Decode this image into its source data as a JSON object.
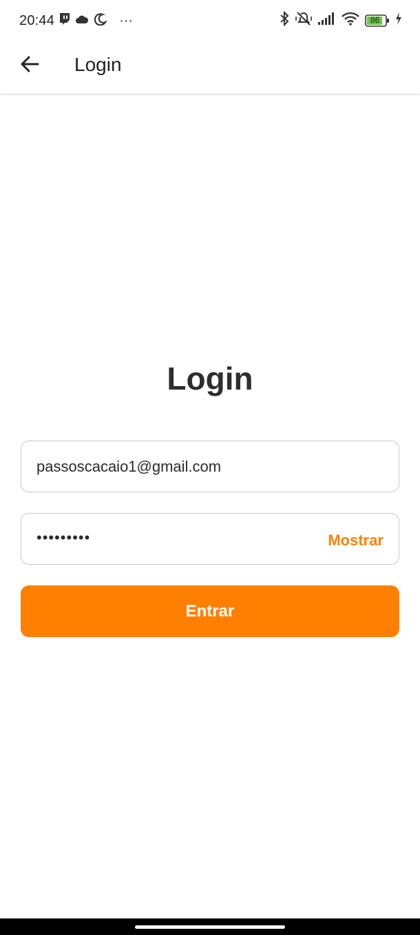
{
  "status_bar": {
    "time": "20:44",
    "left_icons": [
      "twitch-icon",
      "cloud-icon",
      "moon-app-icon",
      "more-dots-icon"
    ],
    "more_dots": "···",
    "right_icons": [
      "bluetooth-icon",
      "vibrate-off-icon",
      "signal-icon",
      "wifi-icon",
      "battery-icon",
      "charging-icon"
    ],
    "battery_level": "86",
    "battery_color": "#6cc644"
  },
  "app_bar": {
    "back_icon": "arrow-left-icon",
    "title": "Login"
  },
  "main": {
    "heading": "Login",
    "email_value": "passoscacaio1@gmail.com",
    "password_masked": "•••••••••",
    "show_password_label": "Mostrar",
    "submit_label": "Entrar"
  },
  "colors": {
    "accent": "#ff8000",
    "accent_text": "#fa8300",
    "field_border": "#c8c8c8"
  }
}
